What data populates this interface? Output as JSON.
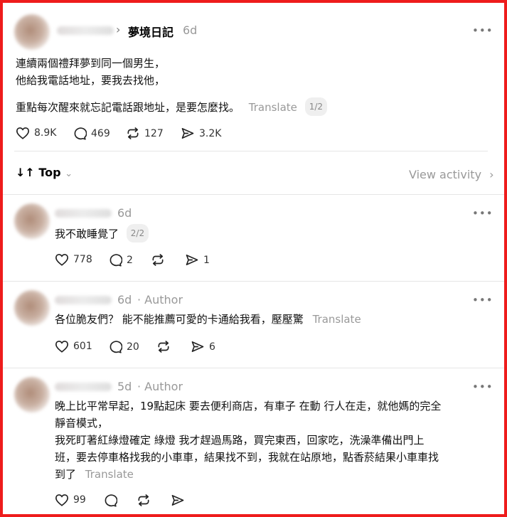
{
  "post": {
    "topic": "夢境日記",
    "time": "6d",
    "more_icon": "more-horizontal-icon",
    "lines": [
      "連續兩個禮拜夢到同一個男生，",
      "他給我電話地址，要我去找他，"
    ],
    "line3": "重點每次醒來就忘記電話跟地址，是要怎麼找。",
    "translate": "Translate",
    "page": "1/2",
    "likes": "8.9K",
    "comments": "469",
    "reposts": "127",
    "shares": "3.2K"
  },
  "sort": {
    "label": "Top",
    "view_activity": "View activity"
  },
  "replies": [
    {
      "time": "6d",
      "author_tag": "",
      "text": "我不敢睡覺了",
      "page": "2/2",
      "likes": "778",
      "comments": "2",
      "reposts": "",
      "shares": "1"
    },
    {
      "time": "6d",
      "author_tag": "· Author",
      "text": "各位脆友們？ 能不能推薦可愛的卡通給我看，壓壓驚",
      "translate": "Translate",
      "likes": "601",
      "comments": "20",
      "reposts": "",
      "shares": "6"
    },
    {
      "time": "5d",
      "author_tag": "· Author",
      "lines": [
        "晚上比平常早起，19點起床 要去便利商店，有車子 在動 行人在走，就他媽的完全",
        "靜音模式，",
        "我死盯著紅綠燈確定 綠燈 我才趕過馬路，買完東西，回家吃，洗澡準備出門上",
        "班，要去停車格找我的小車車，結果找不到，我就在站原地，點香菸結果小車車找",
        "到了"
      ],
      "translate": "Translate",
      "likes": "99",
      "comments": "",
      "reposts": "",
      "shares": ""
    }
  ]
}
